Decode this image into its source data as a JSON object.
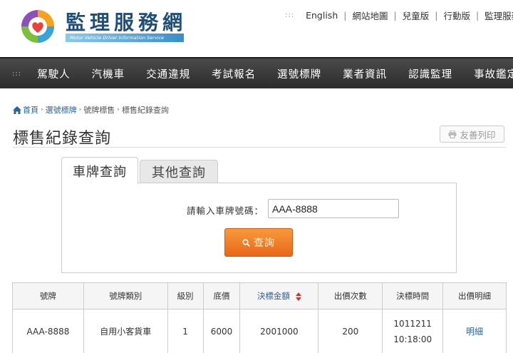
{
  "header": {
    "site_title": "監理服務網",
    "site_subtitle": "Motor Vehicle Driver Information Service",
    "top_links": [
      "English",
      "網站地圖",
      "兒童版",
      "行動版",
      "監理服務 A"
    ]
  },
  "nav": {
    "items": [
      "駕駛人",
      "汽機車",
      "交通違規",
      "考試報名",
      "選號標牌",
      "業者資訊",
      "認識監理",
      "事故鑑定"
    ]
  },
  "breadcrumb": {
    "home": "首頁",
    "level1": "選號標牌",
    "level2": "號牌標售",
    "current": "標售紀錄查詢"
  },
  "page": {
    "title": "標售紀錄查詢",
    "print_label": "友善列印"
  },
  "tabs": {
    "active": "車牌查詢",
    "other": "其他查詢"
  },
  "form": {
    "label": "請輸入車牌號碼：",
    "plate_value": "AAA-8888",
    "submit_label": "查詢"
  },
  "table": {
    "headers": [
      "號牌",
      "號牌類別",
      "級別",
      "底價",
      "決標金額",
      "出價次數",
      "決標時間",
      "出價明細"
    ],
    "rows": [
      {
        "plate": "AAA-8888",
        "category": "自用小客貨車",
        "grade": "1",
        "base_price": "6000",
        "winning_bid": "2001000",
        "bid_count": "200",
        "time_date": "1011211",
        "time_clock": "10:18:00",
        "detail": "明細"
      }
    ]
  },
  "colors": {
    "accent_orange": "#e9661a",
    "link_blue": "#2a6496",
    "brand_blue": "#1f4f7a",
    "sort_red": "#d9302c"
  }
}
